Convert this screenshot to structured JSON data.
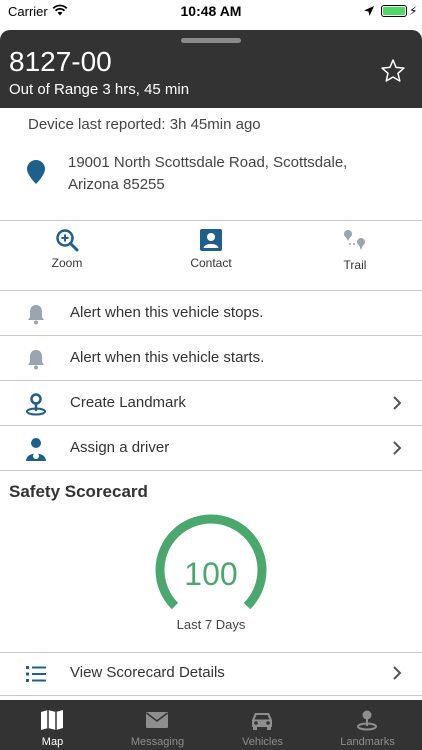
{
  "status_bar": {
    "carrier": "Carrier",
    "time": "10:48 AM"
  },
  "header": {
    "vehicle_id": "8127-00",
    "status": "Out of Range 3 hrs, 45 min"
  },
  "device": {
    "last_reported": "Device last reported: 3h 45min ago"
  },
  "address": {
    "line1": "19001 North Scottsdale Road, Scottsdale,",
    "line2": "Arizona 85255"
  },
  "actions": [
    {
      "label": "Zoom",
      "icon": "zoom-icon"
    },
    {
      "label": "Contact",
      "icon": "contact-icon"
    },
    {
      "label": "Trail",
      "icon": "trail-icon"
    }
  ],
  "rows": [
    {
      "label": "Alert when this vehicle stops.",
      "icon": "bell-icon"
    },
    {
      "label": "Alert when this vehicle starts.",
      "icon": "bell-icon"
    },
    {
      "label": "Create Landmark",
      "icon": "landmark-pin-icon"
    },
    {
      "label": "Assign a driver",
      "icon": "driver-icon"
    }
  ],
  "scorecard": {
    "title": "Safety Scorecard",
    "score": "100",
    "period": "Last 7 Days",
    "details_label": "View Scorecard Details",
    "level_fraction": 1.0
  },
  "tabs": [
    {
      "label": "Map",
      "icon": "map-icon",
      "active": true
    },
    {
      "label": "Messaging",
      "icon": "mail-icon",
      "active": false
    },
    {
      "label": "Vehicles",
      "icon": "car-icon",
      "active": false
    },
    {
      "label": "Landmarks",
      "icon": "landmark-icon",
      "active": false
    }
  ],
  "colors": {
    "accent": "#1f5f8b",
    "gauge": "#4aa86e",
    "header": "#333333"
  }
}
